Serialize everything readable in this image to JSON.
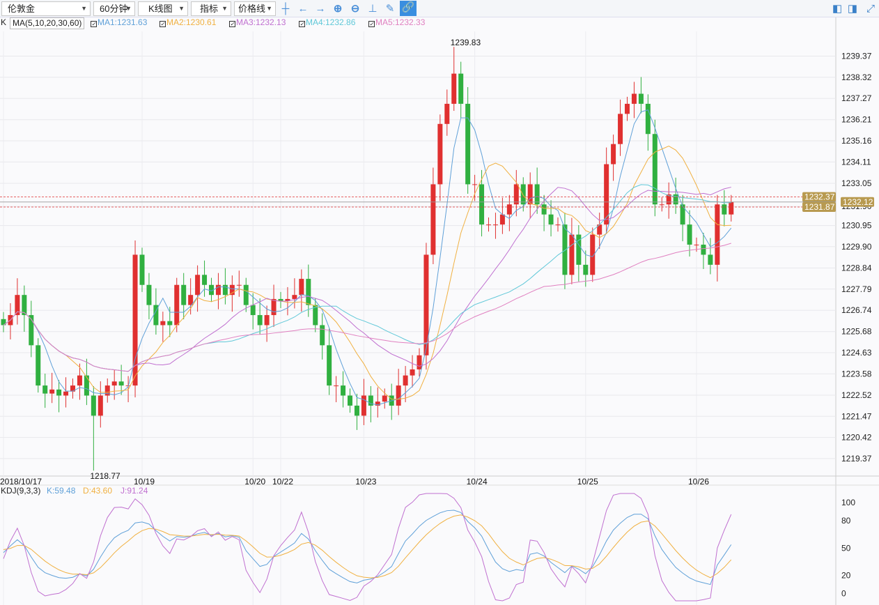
{
  "toolbar": {
    "symbol": "伦敦金",
    "period": "60分钟",
    "chart_type": "K线图",
    "indicator": "指标",
    "price_line": "价格线"
  },
  "legend": {
    "k": "K",
    "ma_params": "MA(5,10,20,30,60)",
    "ma": [
      {
        "label": "MA1:1231.63",
        "color": "#5fa0d8"
      },
      {
        "label": "MA2:1230.61",
        "color": "#f0b040"
      },
      {
        "label": "MA3:1232.13",
        "color": "#c070d0"
      },
      {
        "label": "MA4:1232.86",
        "color": "#60c8d8"
      },
      {
        "label": "MA5:1232.33",
        "color": "#e080c0"
      }
    ]
  },
  "kdj_legend": {
    "name": "KDJ(9,3,3)",
    "k": "K:59.48",
    "d": "D:43.60",
    "j": "J:91.24"
  },
  "colors": {
    "up": "#e03030",
    "down": "#30b040",
    "tag": "#b89a50"
  },
  "chart_data": {
    "type": "candlestick",
    "ylim": [
      1218.5,
      1240.6
    ],
    "yticks": [
      "1239.37",
      "1238.32",
      "1237.27",
      "1236.21",
      "1235.16",
      "1234.11",
      "1233.05",
      "1231.90",
      "1230.95",
      "1229.90",
      "1228.84",
      "1227.79",
      "1226.74",
      "1225.68",
      "1224.63",
      "1223.58",
      "1222.52",
      "1221.47",
      "1220.42",
      "1219.37"
    ],
    "close": [
      1226,
      1226.5,
      1227.5,
      1226.5,
      1225,
      1223,
      1222.6,
      1222.8,
      1222.5,
      1222.7,
      1223,
      1223.5,
      1222.5,
      1221.5,
      1222.5,
      1223,
      1223.2,
      1223,
      1223,
      1229.5,
      1228,
      1227,
      1226,
      1226.2,
      1226,
      1228,
      1227,
      1227.5,
      1228.5,
      1228,
      1227.5,
      1228,
      1227.5,
      1228,
      1228,
      1227,
      1226.5,
      1226,
      1226.5,
      1227.3,
      1227.2,
      1227.3,
      1227.5,
      1228.3,
      1227,
      1226,
      1225,
      1223,
      1223,
      1222.5,
      1222,
      1221.5,
      1222.5,
      1222,
      1222.2,
      1222.5,
      1222,
      1223,
      1223.5,
      1223.8,
      1224.5,
      1229.5,
      1233,
      1236,
      1237,
      1238.5,
      1237,
      1233,
      1233,
      1231,
      1231,
      1231,
      1231.5,
      1232,
      1233,
      1232,
      1233,
      1232,
      1231.5,
      1231,
      1231,
      1228.5,
      1230.5,
      1229,
      1228.5,
      1230.5,
      1231,
      1234,
      1235,
      1236.5,
      1237,
      1237.5,
      1237,
      1235.5,
      1232,
      1232,
      1232.5,
      1232,
      1231,
      1230,
      1230,
      1229.5,
      1229,
      1232,
      1231.5,
      1232.12
    ],
    "high_label": "1239.83",
    "high_index": 65,
    "low_label": "1218.77",
    "low_index": 13,
    "price_tags": [
      "1232.37",
      "1232.12",
      "1231.87"
    ],
    "xticks": [
      {
        "label": "2018/10/17",
        "i": 0
      },
      {
        "label": "10/19",
        "i": 20
      },
      {
        "label": "10/20",
        "i": 36
      },
      {
        "label": "10/22",
        "i": 40
      },
      {
        "label": "10/23",
        "i": 52
      },
      {
        "label": "10/24",
        "i": 68
      },
      {
        "label": "10/25",
        "i": 84
      },
      {
        "label": "10/26",
        "i": 100
      }
    ],
    "ma_periods": [
      5,
      10,
      20,
      30,
      60
    ],
    "kdj_ylim": [
      -8,
      110
    ],
    "kdj_yticks": [
      "100",
      "80",
      "50",
      "20",
      "0"
    ]
  }
}
